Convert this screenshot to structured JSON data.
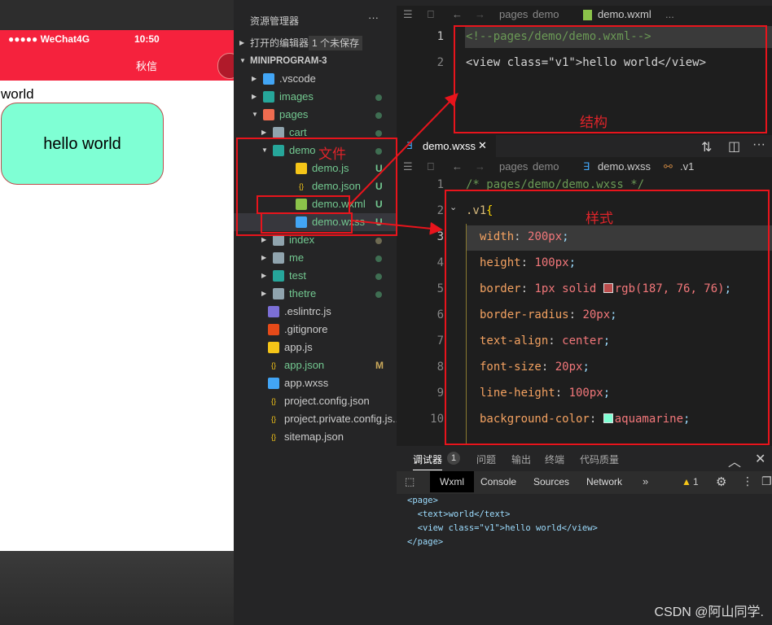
{
  "simulator": {
    "status": "●●●●● WeChat4G",
    "time": "10:50",
    "nav_title": "秋信",
    "page_text": "world",
    "view_text": "hello world",
    "nav_color": "#f5223d"
  },
  "explorer": {
    "title": "资源管理器",
    "more": "···",
    "open_editors": "打开的编辑器",
    "unsaved": "1 个未保存",
    "project": "MINIPROGRAM-3",
    "items": [
      {
        "name": ".vscode",
        "depth": 1,
        "folder": true,
        "open": false,
        "icon": "vscode-folder-icon",
        "status": ""
      },
      {
        "name": "images",
        "depth": 1,
        "folder": true,
        "open": false,
        "icon": "images-folder-icon",
        "status": "dot"
      },
      {
        "name": "pages",
        "depth": 1,
        "folder": true,
        "open": true,
        "icon": "pages-folder-icon",
        "status": "dot"
      },
      {
        "name": "cart",
        "depth": 2,
        "folder": true,
        "open": false,
        "icon": "folder-icon",
        "status": "dot"
      },
      {
        "name": "demo",
        "depth": 2,
        "folder": true,
        "open": true,
        "icon": "demo-folder-icon",
        "status": "dot"
      },
      {
        "name": "demo.js",
        "depth": 3,
        "icon": "js-file-icon",
        "status": "U"
      },
      {
        "name": "demo.json",
        "depth": 3,
        "icon": "json-file-icon",
        "status": "U"
      },
      {
        "name": "demo.wxml",
        "depth": 3,
        "icon": "wxml-file-icon",
        "status": "U"
      },
      {
        "name": "demo.wxss",
        "depth": 3,
        "icon": "wxss-file-icon",
        "status": "U"
      },
      {
        "name": "index",
        "depth": 2,
        "folder": true,
        "open": false,
        "icon": "folder-icon",
        "status": "dot"
      },
      {
        "name": "me",
        "depth": 2,
        "folder": true,
        "open": false,
        "icon": "folder-icon",
        "status": "dot"
      },
      {
        "name": "test",
        "depth": 2,
        "folder": true,
        "open": false,
        "icon": "test-folder-icon",
        "status": "dot"
      },
      {
        "name": "thetre",
        "depth": 2,
        "folder": true,
        "open": false,
        "icon": "folder-icon",
        "status": "dot"
      },
      {
        "name": ".eslintrc.js",
        "depth": 1,
        "icon": "eslint-file-icon",
        "status": ""
      },
      {
        "name": ".gitignore",
        "depth": 1,
        "icon": "git-file-icon",
        "status": ""
      },
      {
        "name": "app.js",
        "depth": 1,
        "icon": "js-file-icon",
        "status": ""
      },
      {
        "name": "app.json",
        "depth": 1,
        "icon": "json-file-icon",
        "status": "M"
      },
      {
        "name": "app.wxss",
        "depth": 1,
        "icon": "wxss-file-icon",
        "status": ""
      },
      {
        "name": "project.config.json",
        "depth": 1,
        "icon": "json-file-icon",
        "status": ""
      },
      {
        "name": "project.private.config.js...",
        "depth": 1,
        "icon": "json-file-icon",
        "status": ""
      },
      {
        "name": "sitemap.json",
        "depth": 1,
        "icon": "json-file-icon",
        "status": ""
      }
    ]
  },
  "editor1": {
    "breadcrumb": [
      "pages",
      "demo",
      "demo.wxml",
      "..."
    ],
    "lines": [
      "<!--pages/demo/demo.wxml-->",
      "<view class=\"v1\">hello world</view>"
    ]
  },
  "editor2": {
    "tab": "demo.wxss",
    "breadcrumb": [
      "pages",
      "demo",
      "demo.wxss",
      ".v1"
    ],
    "comment": "/* pages/demo/demo.wxss */",
    "selector": ".v1",
    "brace": "{",
    "props": [
      {
        "p": "width",
        "v": "200px"
      },
      {
        "p": "height",
        "v": "100px"
      },
      {
        "p": "border",
        "v": "1px solid ",
        "color": "rgb(187, 76, 76)",
        "swatch": "#bb4c4c"
      },
      {
        "p": "border-radius",
        "v": "20px"
      },
      {
        "p": "text-align",
        "v": "center"
      },
      {
        "p": "font-size",
        "v": "20px"
      },
      {
        "p": "line-height",
        "v": "100px"
      },
      {
        "p": "background-color",
        "v": "",
        "color": "aquamarine",
        "swatch": "#7fffd4"
      }
    ]
  },
  "annotations": {
    "file": "文件",
    "structure": "结构",
    "style": "样式"
  },
  "debugger": {
    "tabs": [
      "调试器",
      "问题",
      "输出",
      "终端",
      "代码质量"
    ],
    "badge": "1",
    "subtabs": [
      "Wxml",
      "Console",
      "Sources",
      "Network"
    ],
    "more": "»",
    "warnings": "1",
    "xml": [
      "<page>",
      "  <text>world</text>",
      "  <view class=\"v1\">hello world</view>",
      "</page>"
    ]
  },
  "watermark": "CSDN @阿山同学."
}
